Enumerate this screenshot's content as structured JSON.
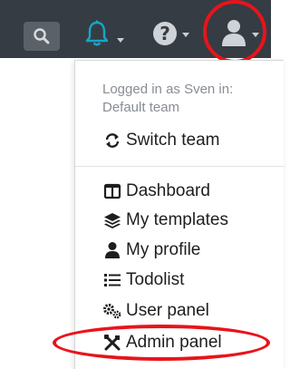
{
  "topbar": {
    "icons": [
      "search-icon",
      "bell-icon",
      "help-icon",
      "user-icon"
    ],
    "help_glyph": "?",
    "colors": {
      "background": "#353c44",
      "bell": "#17a6c4",
      "icon_gray": "#cfd3d8",
      "highlight": "#e8141b"
    }
  },
  "user_menu": {
    "logged_in_line1": "Logged in as Sven in:",
    "logged_in_line2": "Default team",
    "switch_team": "Switch team",
    "items": [
      {
        "label": "Dashboard",
        "icon": "columns-icon"
      },
      {
        "label": "My templates",
        "icon": "layers-icon"
      },
      {
        "label": "My profile",
        "icon": "user-icon"
      },
      {
        "label": "Todolist",
        "icon": "list-icon"
      },
      {
        "label": "User panel",
        "icon": "cogs-icon"
      },
      {
        "label": "Admin panel",
        "icon": "tools-icon"
      }
    ]
  }
}
